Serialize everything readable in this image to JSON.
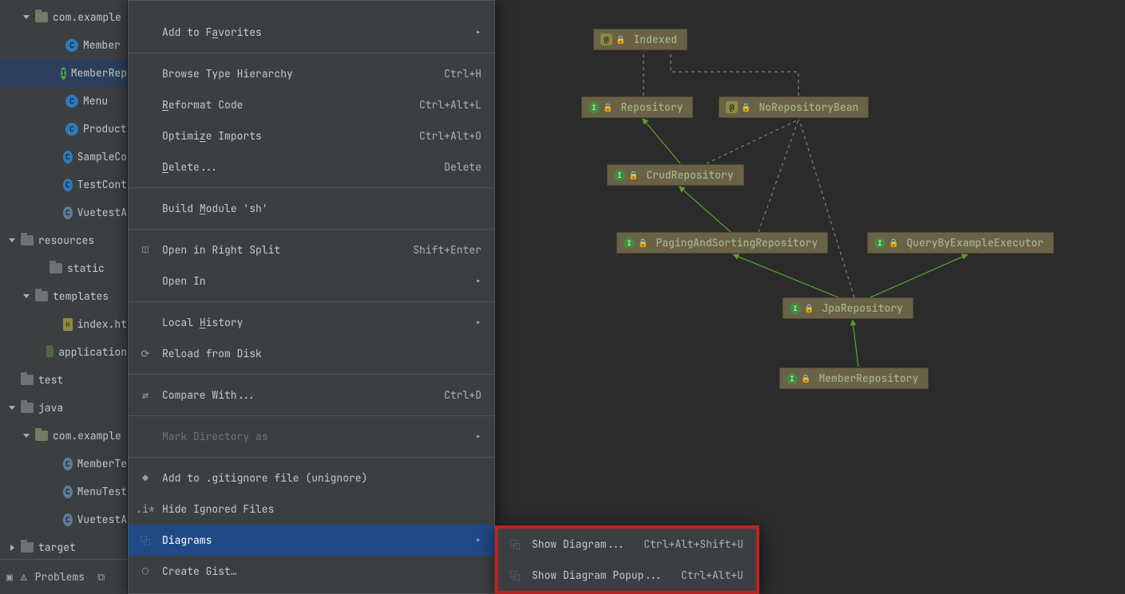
{
  "tree": {
    "rows": [
      {
        "indent": "pad1",
        "icon": "pkg",
        "arrow": "down",
        "label": "com.example"
      },
      {
        "indent": "pad3",
        "icon": "class",
        "label": "Member"
      },
      {
        "indent": "pad3",
        "icon": "classg",
        "label": "MemberRep",
        "selected": true
      },
      {
        "indent": "pad3",
        "icon": "class",
        "label": "Menu"
      },
      {
        "indent": "pad3",
        "icon": "class",
        "label": "Product"
      },
      {
        "indent": "pad3",
        "icon": "class",
        "label": "SampleCo"
      },
      {
        "indent": "pad3",
        "icon": "class",
        "label": "TestCont"
      },
      {
        "indent": "pad3",
        "icon": "classc",
        "label": "VuetestA"
      },
      {
        "indent": "pad0",
        "icon": "folder",
        "arrow": "down",
        "label": "resources"
      },
      {
        "indent": "pad2",
        "icon": "folder",
        "label": "static"
      },
      {
        "indent": "pad1",
        "icon": "folder",
        "arrow": "down",
        "label": "templates"
      },
      {
        "indent": "pad3",
        "icon": "html",
        "label": "index.ht"
      },
      {
        "indent": "pad2",
        "icon": "greensq",
        "label": "application"
      },
      {
        "indent": "pad0",
        "icon": "folder",
        "label": "test"
      },
      {
        "indent": "pad0",
        "icon": "folder",
        "arrow": "down",
        "label": "java"
      },
      {
        "indent": "pad1",
        "icon": "pkg",
        "arrow": "down",
        "label": "com.example"
      },
      {
        "indent": "pad3",
        "icon": "classc",
        "label": "MemberTe"
      },
      {
        "indent": "pad3",
        "icon": "classc",
        "label": "MenuTest"
      },
      {
        "indent": "pad3",
        "icon": "classc",
        "label": "VuetestA"
      },
      {
        "indent": "pad0",
        "icon": "folder",
        "arrow": "right",
        "label": "target"
      }
    ],
    "problems_label": "Problems"
  },
  "menu": {
    "items": [
      {
        "type": "item",
        "label_html": "Add to F<span class='u'>a</span>vorites",
        "submenu": true
      },
      {
        "type": "sep"
      },
      {
        "type": "item",
        "label_html": "Browse Type Hierarchy",
        "shortcut": "Ctrl+H"
      },
      {
        "type": "item",
        "label_html": "<span class='u'>R</span>eformat Code",
        "shortcut": "Ctrl+Alt+L"
      },
      {
        "type": "item",
        "label_html": "Optimi<span class='u'>z</span>e Imports",
        "shortcut": "Ctrl+Alt+O"
      },
      {
        "type": "item",
        "label_html": "<span class='u'>D</span>elete...",
        "shortcut": "Delete"
      },
      {
        "type": "sep"
      },
      {
        "type": "item",
        "label_html": "Build <span class='u'>M</span>odule 'sh'"
      },
      {
        "type": "sep"
      },
      {
        "type": "item",
        "icon": "split",
        "label_html": "Open in Right Split",
        "shortcut": "Shift+Enter"
      },
      {
        "type": "item",
        "label_html": "Open In",
        "submenu": true
      },
      {
        "type": "sep"
      },
      {
        "type": "item",
        "label_html": "Local <span class='u'>H</span>istory",
        "submenu": true
      },
      {
        "type": "item",
        "icon": "reload",
        "label_html": "Reload from Disk"
      },
      {
        "type": "sep"
      },
      {
        "type": "item",
        "icon": "compare",
        "label_html": "Compare With...",
        "shortcut": "Ctrl+D"
      },
      {
        "type": "sep"
      },
      {
        "type": "item",
        "label_html": "Mark Directory as",
        "submenu": true,
        "disabled": true
      },
      {
        "type": "sep"
      },
      {
        "type": "item",
        "icon": "git",
        "label_html": "Add to .gitignore file (unignore)"
      },
      {
        "type": "item",
        "icon": "dotstar",
        "label_html": "Hide Ignored Files"
      },
      {
        "type": "item",
        "icon": "diagram",
        "label_html": "Diagrams",
        "submenu": true,
        "highlight": true
      },
      {
        "type": "item",
        "icon": "github",
        "label_html": "Create Gist…"
      }
    ]
  },
  "submenu": {
    "items": [
      {
        "icon": "diagram",
        "label": "Show Diagram...",
        "shortcut": "Ctrl+Alt+Shift+U"
      },
      {
        "icon": "diagram",
        "label": "Show Diagram Popup...",
        "shortcut": "Ctrl+Alt+U"
      }
    ]
  },
  "diagram": {
    "nodes": {
      "indexed": "Indexed",
      "repository": "Repository",
      "norepobean": "NoRepositoryBean",
      "crudrepo": "CrudRepository",
      "paging": "PagingAndSortingRepository",
      "qbe": "QueryByExampleExecutor",
      "jparepo": "JpaRepository",
      "memberrepo": "MemberRepository"
    }
  }
}
